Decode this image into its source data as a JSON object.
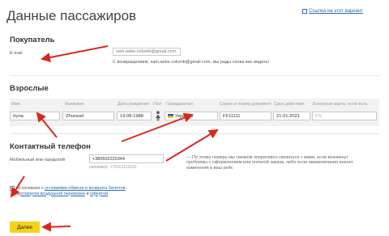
{
  "page": {
    "title": "Данные пассажиров",
    "top_link": "Ссылка на этот вариант",
    "link_icon": "link-icon"
  },
  "buyer": {
    "heading": "Покупатель",
    "email_label": "E-mail",
    "email_value": "sam.aebe.columb@gmail.com",
    "welcome": "С возвращением, sam.aebe.columb@gmail.com, мы рады снова вас видеть!"
  },
  "adults": {
    "heading": "Взрослые",
    "columns": [
      "Имя",
      "Фамилия",
      "Дата рождения",
      "Пол",
      "Гражданство",
      "Серия и номер документа",
      "Срок действия",
      "Бонусная карта, если есть"
    ],
    "row": {
      "first_name": "Iryna",
      "last_name": "Zhuravel",
      "birth_date": "19.08.1988",
      "gender_icon": "female-icon",
      "citizenship": "Украина",
      "flag_icon": "ukraine-flag-icon",
      "document": "FF11111",
      "expiry": "21.01.2021",
      "bonus_placeholder": "PS"
    }
  },
  "contact": {
    "heading": "Контактный телефон",
    "phone_label": "Мобильный или городской",
    "phone_value": "+380502220344",
    "phone_example": "например: +79161112233",
    "hint": "— По этому номеру мы сможем оперативно связаться с вами, если возникнут проблемы с оформлением или оплатой заказа, либо если авиакомпания внесет изменения в ваш рейс"
  },
  "agreement": {
    "checked": true,
    "check_glyph": "✓",
    "text_prefix": "Я согласен с",
    "link1": "условиями обмена и возврата билетов",
    "comma": ",",
    "link2": "договором воздушной перевозки",
    "and": "и",
    "link3": "офертой"
  },
  "actions": {
    "submit": "Далее"
  },
  "colors": {
    "arrow": "#d9271c",
    "button": "#f6d21b",
    "link": "#2b6cb0"
  }
}
